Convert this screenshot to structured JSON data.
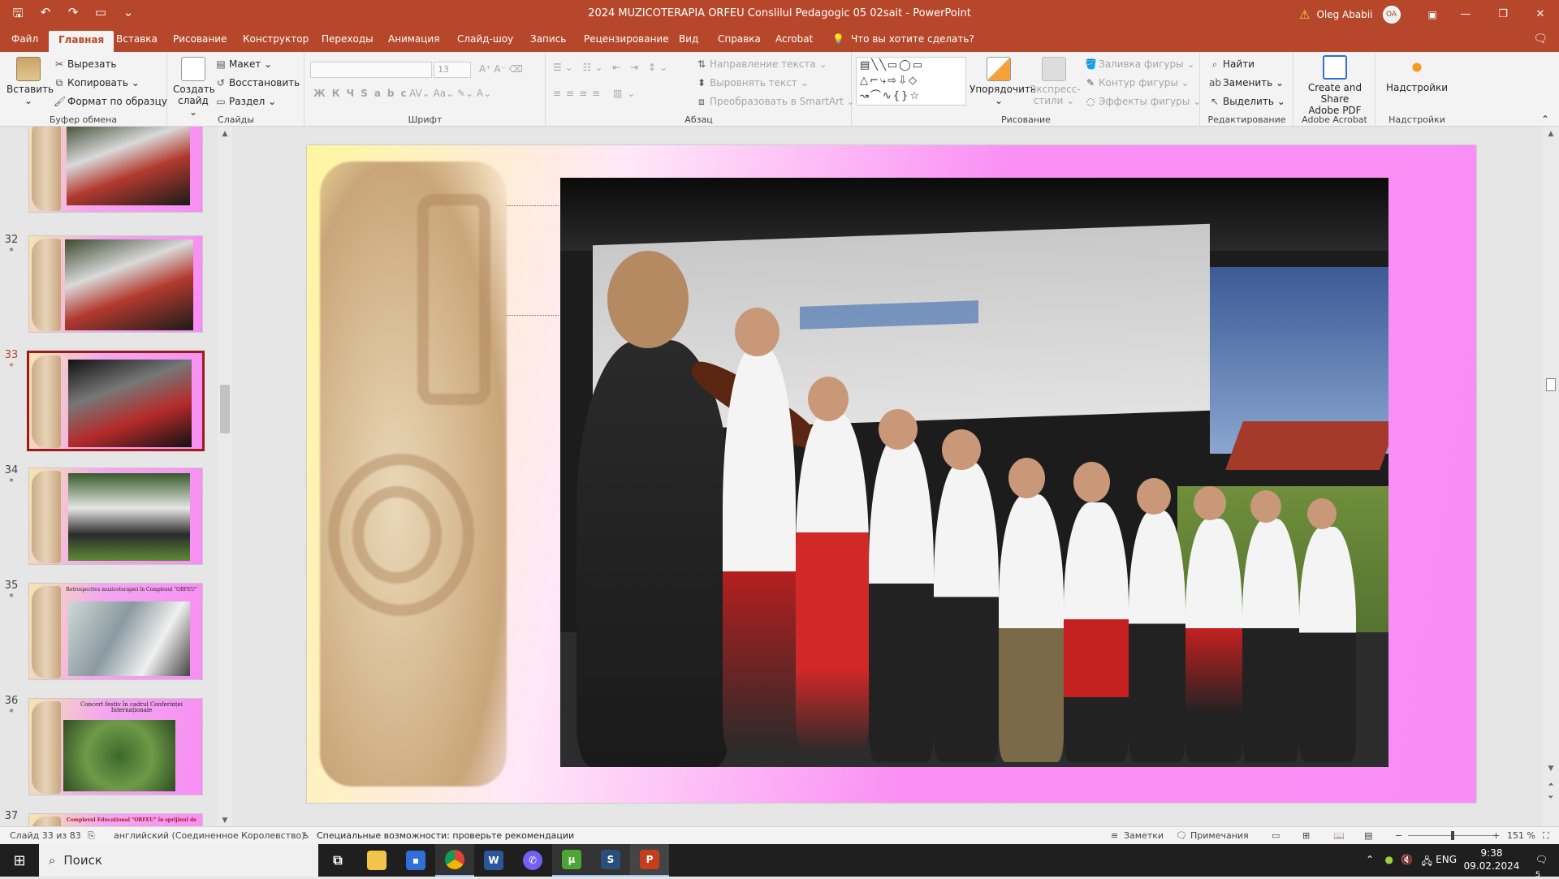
{
  "window": {
    "title": "2024 MUZICOTERAPIA ORFEU Conslilul Pedagogic 05 02sait  -  PowerPoint",
    "user": "Oleg Ababii",
    "user_initials": "OA"
  },
  "tabs": [
    "Файл",
    "Главная",
    "Вставка",
    "Рисование",
    "Конструктор",
    "Переходы",
    "Анимация",
    "Слайд-шоу",
    "Запись",
    "Рецензирование",
    "Вид",
    "Справка",
    "Acrobat"
  ],
  "tell_me": "Что вы хотите сделать?",
  "ribbon": {
    "clipboard": {
      "label": "Буфер обмена",
      "paste": "Вставить",
      "cut": "Вырезать",
      "copy": "Копировать",
      "format_painter": "Формат по образцу"
    },
    "slides": {
      "label": "Слайды",
      "new_slide_1": "Создать",
      "new_slide_2": "слайд",
      "layout": "Макет",
      "reset": "Восстановить",
      "section": "Раздел"
    },
    "font": {
      "label": "Шрифт",
      "size": "13"
    },
    "paragraph": {
      "label": "Абзац",
      "text_direction": "Направление текста",
      "align_text": "Выровнять текст",
      "smartart": "Преобразовать в SmartArt"
    },
    "drawing": {
      "label": "Рисование",
      "arrange": "Упорядочить",
      "quick_styles_1": "Экспресс-",
      "quick_styles_2": "стили",
      "fill": "Заливка фигуры",
      "outline": "Контур фигуры",
      "effects": "Эффекты фигуры"
    },
    "editing": {
      "label": "Редактирование",
      "find": "Найти",
      "replace": "Заменить",
      "select": "Выделить"
    },
    "acrobat": {
      "label": "Adobe Acrobat",
      "create_1": "Create and Share",
      "create_2": "Adobe PDF"
    },
    "addins": {
      "label": "Надстройки",
      "button": "Надстройки"
    }
  },
  "thumbnails": [
    {
      "num": "",
      "text": ""
    },
    {
      "num": "32",
      "text": ""
    },
    {
      "num": "33",
      "text": ""
    },
    {
      "num": "34",
      "text": ""
    },
    {
      "num": "35",
      "text": "Retrospectiva muzicoterapiei în Complexul \"ORFEU\""
    },
    {
      "num": "36",
      "text": "Concert festiv în cadrul Conferinței Internaționale"
    },
    {
      "num": "37",
      "text": "Complexul Educațional \"ORFEU\" în sprijinul de"
    }
  ],
  "status": {
    "slide": "Слайд 33 из 83",
    "language": "английский (Соединенное Королевство)",
    "accessibility": "Специальные возможности: проверьте рекомендации",
    "notes": "Заметки",
    "comments": "Примечания",
    "zoom": "151 %"
  },
  "taskbar": {
    "search": "Поиск",
    "lang": "ENG",
    "time": "9:38",
    "date": "09.02.2024",
    "notif": "5"
  }
}
